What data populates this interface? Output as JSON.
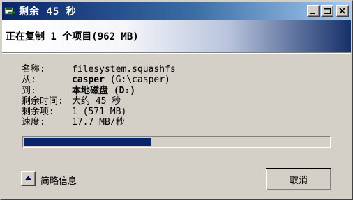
{
  "window": {
    "title": "剩余 45 秒",
    "minimize_icon": "minimize-icon",
    "maximize_icon": "maximize-icon",
    "close_icon": "close-icon"
  },
  "header": {
    "status": "正在复制 1 个项目(962 MB)"
  },
  "details": {
    "name_label": "名称:",
    "name_value": "filesystem.squashfs",
    "from_label": "从:",
    "from_bold": "casper",
    "from_rest": " (G:\\casper)",
    "to_label": "到:",
    "to_value": "本地磁盘 (D:)",
    "time_label": "剩余时间:",
    "time_value": "大约 45 秒",
    "items_label": "剩余项:",
    "items_value": "1 (571 MB)",
    "speed_label": "速度:",
    "speed_value": "17.7 MB/秒"
  },
  "progress": {
    "fraction": 0.42
  },
  "footer": {
    "toggle_label": "简略信息",
    "toggle_icon": "triangle-up-icon",
    "cancel_label": "取消"
  },
  "colors": {
    "accent": "#0a246a",
    "face": "#d4d0c8"
  }
}
